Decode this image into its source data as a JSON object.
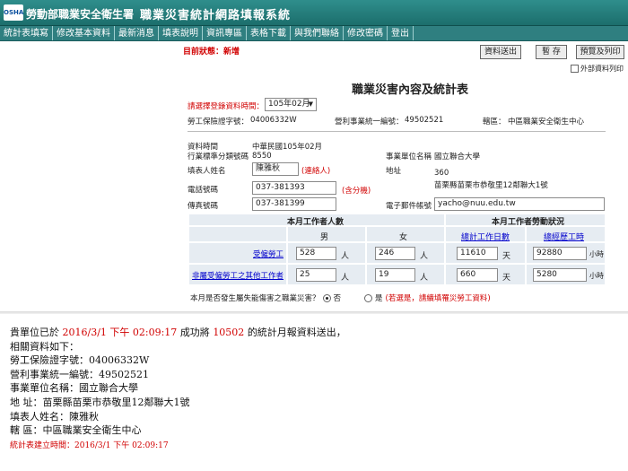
{
  "header": {
    "logo_text": "OSHA",
    "agency": "勞動部職業安全衛生署",
    "system_title": "職業災害統計網路填報系統"
  },
  "menu": [
    "統計表填寫",
    "修改基本資料",
    "最新消息",
    "填表說明",
    "資訊專區",
    "表格下載",
    "與我們聯絡",
    "修改密碼",
    "登出"
  ],
  "status": "目前狀態：新增",
  "toolbar": {
    "submit_label": "資料送出",
    "save_label": "暫 存",
    "preview_label": "預覽及列印",
    "external_print_label": "外部資料列印"
  },
  "form": {
    "title": "職業災害內容及統計表",
    "period_prompt": "請選擇登錄資料時間：",
    "period_value": "105年02月",
    "insurance_label": "勞工保險證字號：",
    "insurance_value": "04006332W",
    "biz_id_label": "營利事業統一編號：",
    "biz_id_value": "49502521",
    "district_label": "轄區：",
    "district_value": "中區職業安全衛生中心",
    "data_time_label": "資料時間",
    "data_time_value": "中華民國105年02月",
    "industry_label": "行業標準分類號碼",
    "industry_value": "8550",
    "unit_name_label": "事業單位名稱",
    "unit_name_value": "國立聯合大學",
    "filler_label": "填表人姓名",
    "filler_value": "陳雅秋",
    "filler_note": "(連絡人)",
    "address_label": "地址",
    "address_zip": "360",
    "address_value": "苗栗縣苗栗市恭敬里12鄰聯大1號",
    "phone_label": "電話號碼",
    "phone_value": "037-381393",
    "phone_note": "(含分機)",
    "fax_label": "傳真號碼",
    "fax_value": "037-381399",
    "email_label": "電子郵件帳號",
    "email_value": "yacho@nuu.edu.tw"
  },
  "table": {
    "workers_header": "本月工作者人數",
    "hours_header": "本月工作者勞動狀況",
    "male_header": "男",
    "female_header": "女",
    "workdays_header": "總計工作日數",
    "workhours_header": "總經歷工時",
    "rows": [
      {
        "label": "受僱勞工",
        "male": "528",
        "female": "246",
        "days": "11610",
        "hours": "92880"
      },
      {
        "label": "非屬受僱勞工之其他工作者",
        "male": "25",
        "female": "19",
        "days": "660",
        "hours": "5280"
      }
    ],
    "unit_person": "人",
    "unit_day": "天",
    "unit_hour": "小時"
  },
  "question": {
    "text": "本月是否發生屬失能傷害之職業災害？",
    "no_label": "否",
    "yes_label": "是",
    "yes_note": "(若選是，請續填罹災勞工資料)"
  },
  "result": {
    "line1_prefix": "貴單位已於",
    "line1_time": "2016/3/1 下午 02:09:17",
    "line1_mid": "成功將",
    "line1_code": "10502",
    "line1_suffix": "的統計月報資料送出，",
    "line2": "相關資料如下：",
    "line3": "勞工保險證字號：04006332W",
    "line4": "營利事業統一編號：49502521",
    "line5": "事業單位名稱：國立聯合大學",
    "line6": "地 址：苗栗縣苗栗市恭敬里12鄰聯大1號",
    "line7": "填表人姓名：陳雅秋",
    "line8": "轄 區：中區職業安全衛生中心",
    "created": "統計表建立時間：2016/3/1 下午 02:09:17"
  },
  "colors": {
    "header": "#1c6e6c",
    "menu": "#2f7f80",
    "accent_red": "#d10000",
    "table_cell": "#e6ecf2"
  }
}
